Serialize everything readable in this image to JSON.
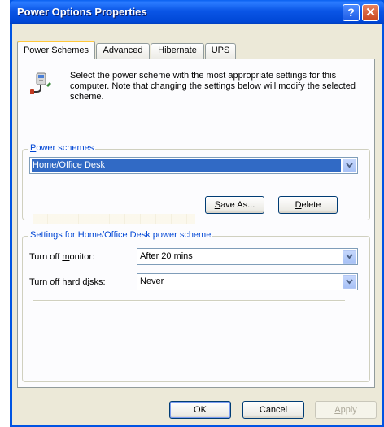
{
  "window": {
    "title": "Power Options Properties",
    "help_glyph": "?",
    "close_glyph": "✕"
  },
  "tabs": [
    {
      "label": "Power Schemes",
      "active": true
    },
    {
      "label": "Advanced",
      "active": false
    },
    {
      "label": "Hibernate",
      "active": false
    },
    {
      "label": "UPS",
      "active": false
    }
  ],
  "intro": {
    "icon": "power-options-icon",
    "text": "Select the power scheme with the most appropriate settings for this computer. Note that changing the settings below will modify the selected scheme."
  },
  "power_schemes": {
    "label_underlined": "P",
    "label_rest": "ower schemes",
    "selected": "Home/Office Desk",
    "save_as": {
      "underlined": "S",
      "rest": "ave As..."
    },
    "delete": {
      "underlined": "D",
      "rest": "elete"
    }
  },
  "settings": {
    "title": "Settings for Home/Office Desk power scheme",
    "monitor": {
      "label_pre": "Turn off ",
      "label_underlined": "m",
      "label_post": "onitor:",
      "value": "After 20 mins"
    },
    "hard_disks": {
      "label_pre": "Turn off hard d",
      "label_underlined": "i",
      "label_post": "sks:",
      "value": "Never"
    }
  },
  "footer": {
    "ok": "OK",
    "cancel": "Cancel",
    "apply": {
      "underlined": "A",
      "rest": "pply",
      "enabled": false
    }
  },
  "colors": {
    "title_bar": "#0054e3",
    "dialog_face": "#ece9d8",
    "selection": "#316ac5",
    "group_label": "#0046d5"
  }
}
